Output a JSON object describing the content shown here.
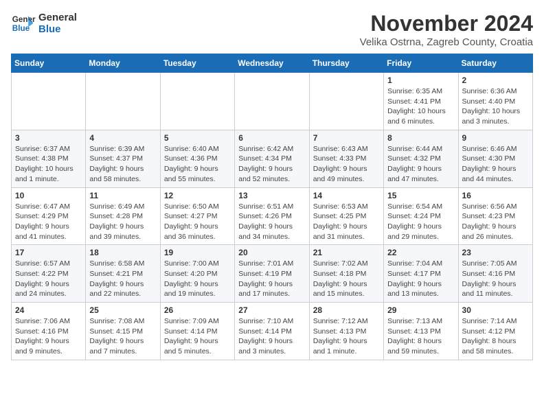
{
  "header": {
    "logo_line1": "General",
    "logo_line2": "Blue",
    "month_title": "November 2024",
    "location": "Velika Ostrna, Zagreb County, Croatia"
  },
  "days_of_week": [
    "Sunday",
    "Monday",
    "Tuesday",
    "Wednesday",
    "Thursday",
    "Friday",
    "Saturday"
  ],
  "weeks": [
    [
      {
        "day": "",
        "info": ""
      },
      {
        "day": "",
        "info": ""
      },
      {
        "day": "",
        "info": ""
      },
      {
        "day": "",
        "info": ""
      },
      {
        "day": "",
        "info": ""
      },
      {
        "day": "1",
        "info": "Sunrise: 6:35 AM\nSunset: 4:41 PM\nDaylight: 10 hours and 6 minutes."
      },
      {
        "day": "2",
        "info": "Sunrise: 6:36 AM\nSunset: 4:40 PM\nDaylight: 10 hours and 3 minutes."
      }
    ],
    [
      {
        "day": "3",
        "info": "Sunrise: 6:37 AM\nSunset: 4:38 PM\nDaylight: 10 hours and 1 minute."
      },
      {
        "day": "4",
        "info": "Sunrise: 6:39 AM\nSunset: 4:37 PM\nDaylight: 9 hours and 58 minutes."
      },
      {
        "day": "5",
        "info": "Sunrise: 6:40 AM\nSunset: 4:36 PM\nDaylight: 9 hours and 55 minutes."
      },
      {
        "day": "6",
        "info": "Sunrise: 6:42 AM\nSunset: 4:34 PM\nDaylight: 9 hours and 52 minutes."
      },
      {
        "day": "7",
        "info": "Sunrise: 6:43 AM\nSunset: 4:33 PM\nDaylight: 9 hours and 49 minutes."
      },
      {
        "day": "8",
        "info": "Sunrise: 6:44 AM\nSunset: 4:32 PM\nDaylight: 9 hours and 47 minutes."
      },
      {
        "day": "9",
        "info": "Sunrise: 6:46 AM\nSunset: 4:30 PM\nDaylight: 9 hours and 44 minutes."
      }
    ],
    [
      {
        "day": "10",
        "info": "Sunrise: 6:47 AM\nSunset: 4:29 PM\nDaylight: 9 hours and 41 minutes."
      },
      {
        "day": "11",
        "info": "Sunrise: 6:49 AM\nSunset: 4:28 PM\nDaylight: 9 hours and 39 minutes."
      },
      {
        "day": "12",
        "info": "Sunrise: 6:50 AM\nSunset: 4:27 PM\nDaylight: 9 hours and 36 minutes."
      },
      {
        "day": "13",
        "info": "Sunrise: 6:51 AM\nSunset: 4:26 PM\nDaylight: 9 hours and 34 minutes."
      },
      {
        "day": "14",
        "info": "Sunrise: 6:53 AM\nSunset: 4:25 PM\nDaylight: 9 hours and 31 minutes."
      },
      {
        "day": "15",
        "info": "Sunrise: 6:54 AM\nSunset: 4:24 PM\nDaylight: 9 hours and 29 minutes."
      },
      {
        "day": "16",
        "info": "Sunrise: 6:56 AM\nSunset: 4:23 PM\nDaylight: 9 hours and 26 minutes."
      }
    ],
    [
      {
        "day": "17",
        "info": "Sunrise: 6:57 AM\nSunset: 4:22 PM\nDaylight: 9 hours and 24 minutes."
      },
      {
        "day": "18",
        "info": "Sunrise: 6:58 AM\nSunset: 4:21 PM\nDaylight: 9 hours and 22 minutes."
      },
      {
        "day": "19",
        "info": "Sunrise: 7:00 AM\nSunset: 4:20 PM\nDaylight: 9 hours and 19 minutes."
      },
      {
        "day": "20",
        "info": "Sunrise: 7:01 AM\nSunset: 4:19 PM\nDaylight: 9 hours and 17 minutes."
      },
      {
        "day": "21",
        "info": "Sunrise: 7:02 AM\nSunset: 4:18 PM\nDaylight: 9 hours and 15 minutes."
      },
      {
        "day": "22",
        "info": "Sunrise: 7:04 AM\nSunset: 4:17 PM\nDaylight: 9 hours and 13 minutes."
      },
      {
        "day": "23",
        "info": "Sunrise: 7:05 AM\nSunset: 4:16 PM\nDaylight: 9 hours and 11 minutes."
      }
    ],
    [
      {
        "day": "24",
        "info": "Sunrise: 7:06 AM\nSunset: 4:16 PM\nDaylight: 9 hours and 9 minutes."
      },
      {
        "day": "25",
        "info": "Sunrise: 7:08 AM\nSunset: 4:15 PM\nDaylight: 9 hours and 7 minutes."
      },
      {
        "day": "26",
        "info": "Sunrise: 7:09 AM\nSunset: 4:14 PM\nDaylight: 9 hours and 5 minutes."
      },
      {
        "day": "27",
        "info": "Sunrise: 7:10 AM\nSunset: 4:14 PM\nDaylight: 9 hours and 3 minutes."
      },
      {
        "day": "28",
        "info": "Sunrise: 7:12 AM\nSunset: 4:13 PM\nDaylight: 9 hours and 1 minute."
      },
      {
        "day": "29",
        "info": "Sunrise: 7:13 AM\nSunset: 4:13 PM\nDaylight: 8 hours and 59 minutes."
      },
      {
        "day": "30",
        "info": "Sunrise: 7:14 AM\nSunset: 4:12 PM\nDaylight: 8 hours and 58 minutes."
      }
    ]
  ]
}
